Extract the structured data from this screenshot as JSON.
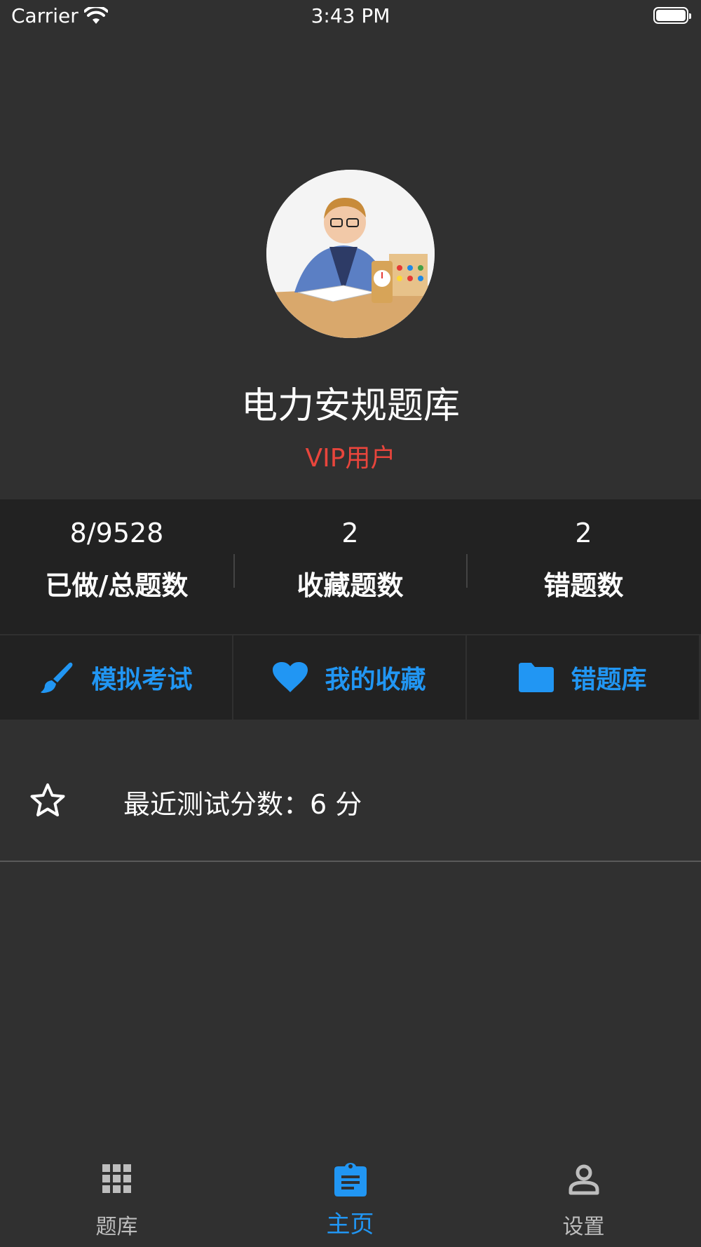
{
  "status_bar": {
    "carrier": "Carrier",
    "time": "3:43 PM"
  },
  "profile": {
    "title": "电力安规题库",
    "vip_label": "VIP用户"
  },
  "stats": [
    {
      "value": "8/9528",
      "label": "已做/总题数"
    },
    {
      "value": "2",
      "label": "收藏题数"
    },
    {
      "value": "2",
      "label": "错题数"
    }
  ],
  "actions": [
    {
      "label": "模拟考试",
      "icon": "brush-icon"
    },
    {
      "label": "我的收藏",
      "icon": "heart-icon"
    },
    {
      "label": "错题库",
      "icon": "folder-icon"
    }
  ],
  "recent_score": {
    "text": "最近测试分数：6 分",
    "icon": "star-outline-icon"
  },
  "tabs": [
    {
      "label": "题库",
      "icon": "grid-icon",
      "active": false
    },
    {
      "label": "主页",
      "icon": "clipboard-icon",
      "active": true
    },
    {
      "label": "设置",
      "icon": "person-icon",
      "active": false
    }
  ],
  "colors": {
    "accent": "#2196f3",
    "vip": "#e8453c",
    "background": "#303030",
    "panel": "#222222"
  }
}
